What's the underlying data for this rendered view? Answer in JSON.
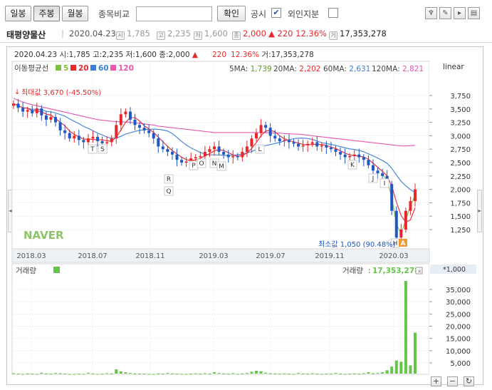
{
  "toolbar": {
    "day_label": "일봉",
    "week_label": "주봉",
    "month_label": "월봉",
    "compare_label": "종목비교",
    "compare_placeholder": "",
    "confirm_label": "확인",
    "notice_label": "공시",
    "notice_checked": "✔",
    "foreign_label": "외인지분",
    "foreign_checked": ""
  },
  "info": {
    "name": "태평양물산",
    "date": "2020.04.23",
    "open_icon": "시",
    "open": "1,785",
    "high_icon": "고",
    "high": "2,235",
    "low_icon": "저",
    "low": "1,600",
    "close_icon": "종",
    "close": "2,000",
    "change_arrow": "▲",
    "change": "220",
    "change_pct": "12.36%",
    "volume_icon": "거",
    "volume": "17,353,278"
  },
  "colors": {
    "up": "#e8262b",
    "down": "#1f57c6",
    "ma5": "#7fbf3d",
    "ma20": "#e8262b",
    "ma60": "#3c7fd6",
    "ma120": "#e957b0",
    "volume": "#64c548"
  },
  "chart_data": [
    {
      "type": "candlestick",
      "title": "",
      "header_line": "2020.04.23 시:1,785 고:2,235 저:1,600 종:2,000 ▲ 220 12.36% 거:17,353,278",
      "ma_legend": {
        "label": "이동평균선",
        "items": [
          "5",
          "20",
          "60",
          "120"
        ]
      },
      "ma_values": {
        "5MA": "1,739",
        "20MA": "2,202",
        "60MA": "2,631",
        "120MA": "2,821"
      },
      "scale": "linear",
      "y_ticks": [
        "3,750",
        "3,500",
        "3,250",
        "3,000",
        "2,750",
        "2,500",
        "2,250",
        "2,000",
        "1,750",
        "1,500",
        "1,250"
      ],
      "x_ticks": [
        "2018.03",
        "2018.07",
        "2018.11",
        "2019.03",
        "2019.07",
        "2019.11",
        "2020.03"
      ],
      "max_label": "최대값 3,670 (-45.50%)",
      "min_label": "최소값 1,050 (90.48%)",
      "watermark": "NAVER",
      "markers": [
        "T",
        "S",
        "R",
        "Q",
        "P",
        "O",
        "N",
        "M",
        "L",
        "K",
        "J",
        "I",
        "H",
        "A"
      ],
      "weekly_close": [
        3600,
        3520,
        3450,
        3480,
        3420,
        3510,
        3380,
        3300,
        3350,
        3250,
        3100,
        3050,
        2950,
        3000,
        2920,
        2880,
        2950,
        2980,
        2900,
        2860,
        2880,
        2950,
        3200,
        3400,
        3450,
        3300,
        3200,
        3150,
        3100,
        3050,
        2950,
        2800,
        2750,
        2700,
        2650,
        2550,
        2500,
        2520,
        2580,
        2600,
        2620,
        2700,
        2750,
        2800,
        2700,
        2650,
        2600,
        2620,
        2600,
        2700,
        2800,
        2950,
        3050,
        3200,
        3150,
        3000,
        2950,
        2900,
        2920,
        2880,
        2850,
        2800,
        2820,
        2850,
        2880,
        2800,
        2820,
        2780,
        2750,
        2700,
        2650,
        2600,
        2620,
        2650,
        2600,
        2550,
        2450,
        2350,
        2300,
        2250,
        2100,
        1600,
        1100,
        1250,
        1600,
        1780,
        2000
      ],
      "ma120": [
        3700,
        3660,
        3630,
        3600,
        3580,
        3560,
        3540,
        3520,
        3500,
        3480,
        3460,
        3440,
        3420,
        3400,
        3380,
        3360,
        3340,
        3320,
        3300,
        3290,
        3280,
        3270,
        3265,
        3260,
        3255,
        3250,
        3240,
        3230,
        3220,
        3210,
        3200,
        3180,
        3170,
        3160,
        3150,
        3140,
        3130,
        3120,
        3110,
        3100,
        3090,
        3080,
        3070,
        3060,
        3060,
        3060,
        3060,
        3060,
        3060,
        3060,
        3060,
        3060,
        3060,
        3060,
        3060,
        3050,
        3050,
        3050,
        3040,
        3040,
        3030,
        3030,
        3020,
        3010,
        3000,
        2990,
        2980,
        2970,
        2960,
        2950,
        2940,
        2930,
        2920,
        2910,
        2900,
        2890,
        2880,
        2870,
        2860,
        2850,
        2840,
        2830,
        2820,
        2810,
        2810,
        2815,
        2821
      ]
    },
    {
      "type": "bar",
      "title": "거래량",
      "legend_value": "17,353,278",
      "unit": "*1,000",
      "y_ticks": [
        "35,000",
        "30,000",
        "25,000",
        "20,000",
        "15,000",
        "10,000",
        "5,000"
      ],
      "values": [
        800,
        600,
        500,
        700,
        600,
        500,
        1000,
        700,
        600,
        900,
        800,
        600,
        500,
        500,
        600,
        500,
        1000,
        700,
        500,
        600,
        800,
        700,
        2400,
        1500,
        1200,
        900,
        700,
        600,
        600,
        500,
        500,
        700,
        600,
        900,
        700,
        600,
        500,
        500,
        600,
        700,
        600,
        800,
        700,
        1200,
        900,
        700,
        600,
        800,
        500,
        700,
        900,
        1400,
        1800,
        1600,
        1000,
        800,
        700,
        600,
        700,
        600,
        500,
        900,
        700,
        600,
        800,
        600,
        500,
        600,
        500,
        900,
        600,
        500,
        600,
        700,
        600,
        800,
        1200,
        800,
        900,
        1200,
        2000,
        3500,
        6000,
        5500,
        38500,
        4000,
        17353
      ]
    }
  ]
}
